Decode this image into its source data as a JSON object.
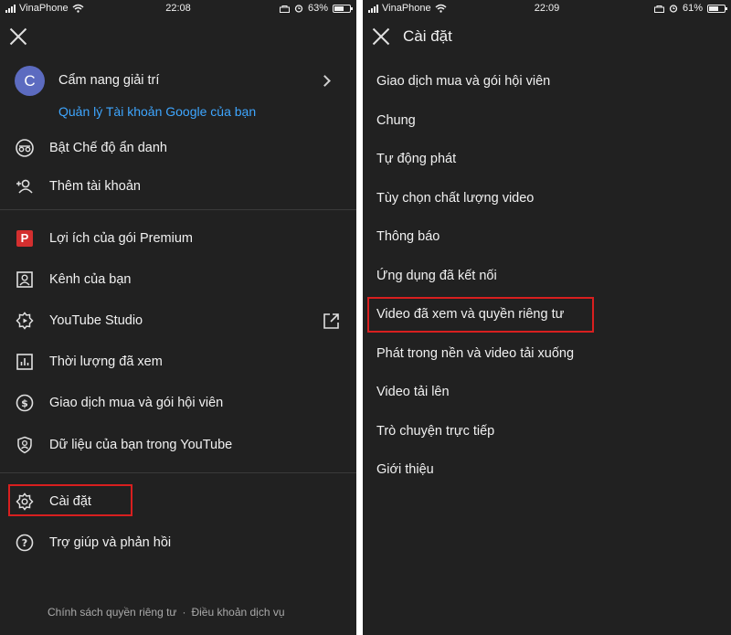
{
  "left": {
    "status": {
      "carrier": "VinaPhone",
      "time": "22:08",
      "battery": "63%",
      "battery_level": 0.63
    },
    "account": {
      "avatar_letter": "C",
      "name": "Cẩm nang giải trí",
      "manage_link": "Quản lý Tài khoản Google của bạn"
    },
    "menu_group1": [
      {
        "label": "Bật Chế độ ẩn danh",
        "icon": "incognito-icon"
      },
      {
        "label": "Thêm tài khoản",
        "icon": "add-account-icon"
      }
    ],
    "menu_group2": [
      {
        "label": "Lợi ích của gói Premium",
        "icon": "premium-icon"
      },
      {
        "label": "Kênh của bạn",
        "icon": "channel-icon"
      },
      {
        "label": "YouTube Studio",
        "icon": "studio-gear-icon"
      },
      {
        "label": "Thời lượng đã xem",
        "icon": "chart-icon"
      },
      {
        "label": "Giao dịch mua và gói hội viên",
        "icon": "dollar-icon"
      },
      {
        "label": "Dữ liệu của bạn trong YouTube",
        "icon": "user-data-icon"
      }
    ],
    "menu_group3": [
      {
        "label": "Cài đặt",
        "icon": "settings-icon"
      },
      {
        "label": "Trợ giúp và phản hồi",
        "icon": "help-icon"
      }
    ],
    "footer": {
      "privacy": "Chính sách quyền riêng tư",
      "separator": "·",
      "terms": "Điều khoản dịch vụ"
    }
  },
  "right": {
    "status": {
      "carrier": "VinaPhone",
      "time": "22:09",
      "battery": "61%",
      "battery_level": 0.61
    },
    "title": "Cài đặt",
    "items": [
      "Giao dịch mua và gói hội viên",
      "Chung",
      "Tự động phát",
      "Tùy chọn chất lượng video",
      "Thông báo",
      "Ứng dụng đã kết nối",
      "Video đã xem và quyền riêng tư",
      "Phát trong nền và video tải xuống",
      "Video tải lên",
      "Trò chuyện trực tiếp",
      "Giới thiệu"
    ]
  },
  "colors": {
    "background": "#212121",
    "link": "#3ea6ff",
    "highlight": "#d81f1f",
    "premium": "#d32f2f"
  }
}
